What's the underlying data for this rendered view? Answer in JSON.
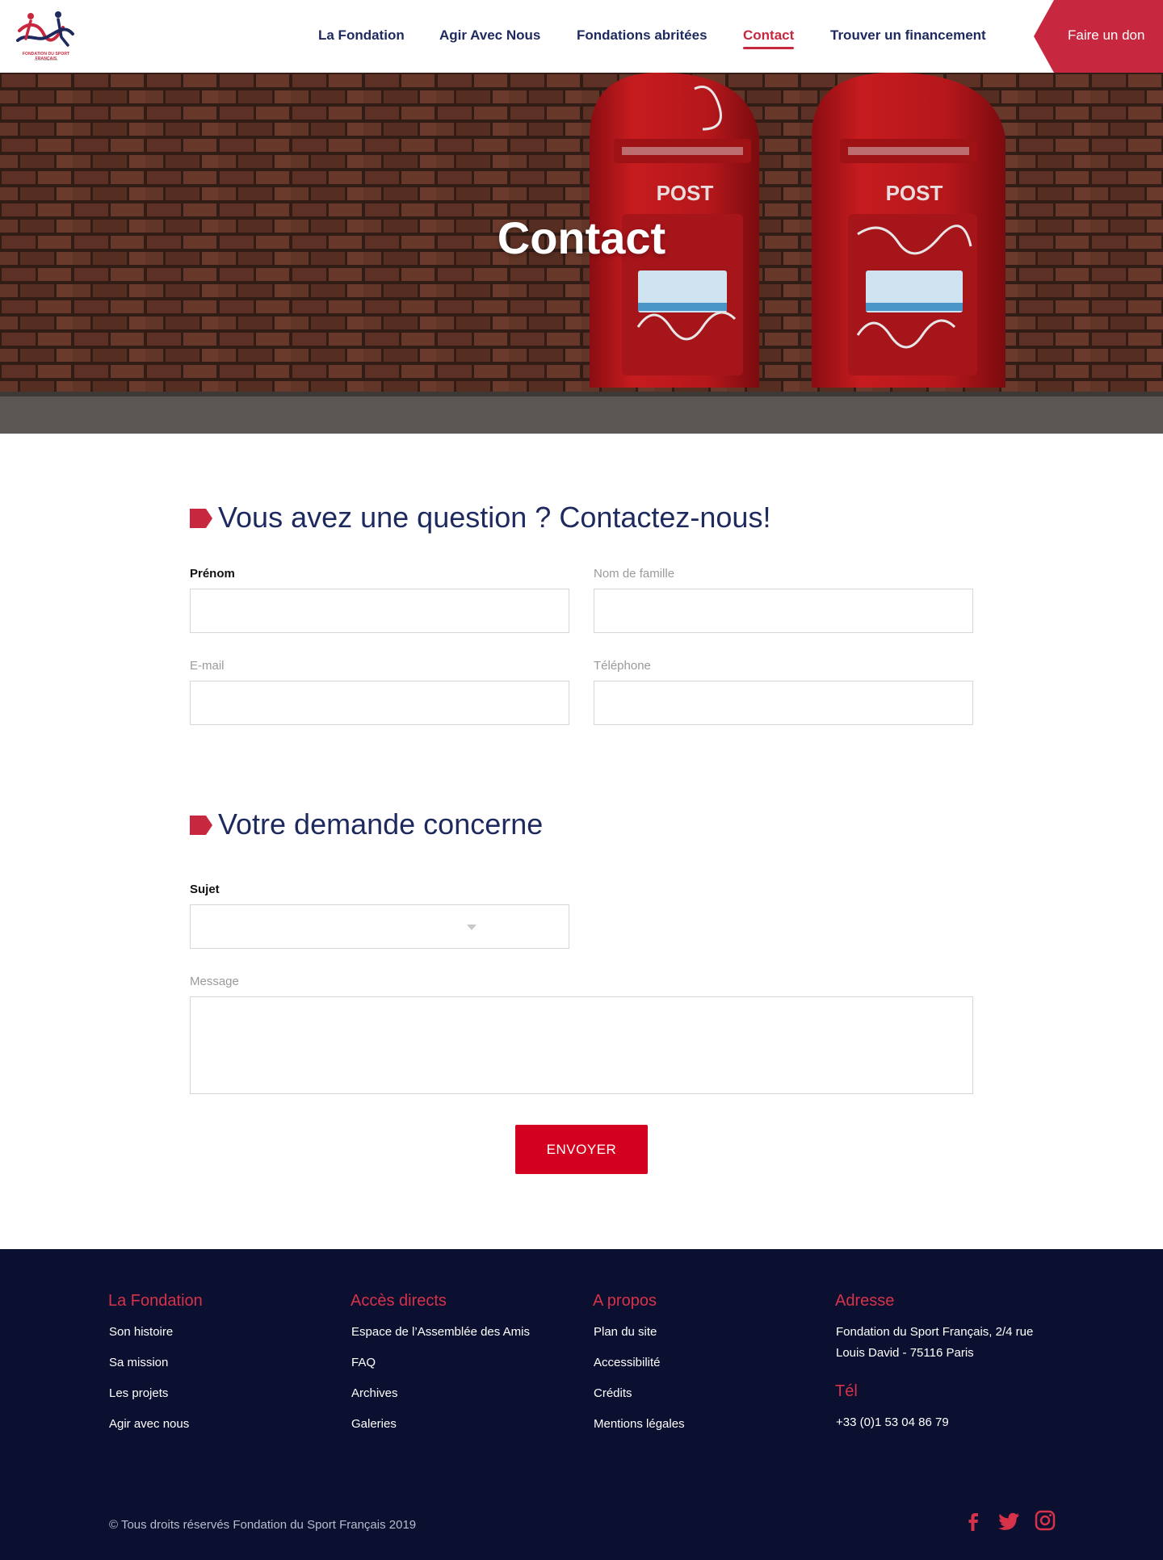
{
  "header": {
    "logo_text": "FONDATION DU SPORT FRANÇAIS",
    "logo_subtext": "HENRI SÉRANDOUR",
    "nav": [
      {
        "label": "La Fondation"
      },
      {
        "label": "Agir Avec Nous"
      },
      {
        "label": "Fondations abritées"
      },
      {
        "label": "Contact"
      },
      {
        "label": "Trouver un financement"
      }
    ],
    "active_nav": "Contact",
    "donate_label": "Faire un don"
  },
  "hero": {
    "title": "Contact"
  },
  "contact_section": {
    "title": "Vous avez une question ? Contactez-nous!",
    "first_name_label": "Prénom",
    "first_name_value": "",
    "last_name_label": "Nom de famille",
    "last_name_value": "",
    "email_label": "E-mail",
    "email_value": "",
    "phone_label": "Téléphone",
    "phone_value": ""
  },
  "request_section": {
    "title": "Votre demande concerne",
    "subject_label": "Sujet",
    "subject_value": "",
    "message_label": "Message",
    "message_value": "",
    "submit_label": "ENVOYER"
  },
  "footer": {
    "fondation": {
      "heading": "La Fondation",
      "links": [
        "Son histoire",
        "Sa mission",
        "Les projets",
        "Agir avec nous"
      ]
    },
    "acces": {
      "heading": "Accès directs",
      "links": [
        "Espace de l’Assemblée des Amis",
        "FAQ",
        "Archives",
        "Galeries"
      ]
    },
    "apropos": {
      "heading": "A propos",
      "links": [
        "Plan du site",
        "Accessibilité",
        "Crédits",
        "Mentions légales"
      ]
    },
    "adresse": {
      "heading": "Adresse",
      "text": "Fondation du Sport Français, 2/4 rue Louis David - 75116 Paris",
      "tel_heading": "Tél",
      "tel": "+33 (0)1 53 04 86 79"
    },
    "copyright": "© Tous droits réservés Fondation du Sport Français 2019",
    "social": [
      "facebook-icon",
      "twitter-icon",
      "instagram-icon"
    ]
  },
  "colors": {
    "brand_red": "#c8283f",
    "navy": "#1e2a5e",
    "footer_bg": "#0b1030",
    "button_red": "#d4001f"
  }
}
